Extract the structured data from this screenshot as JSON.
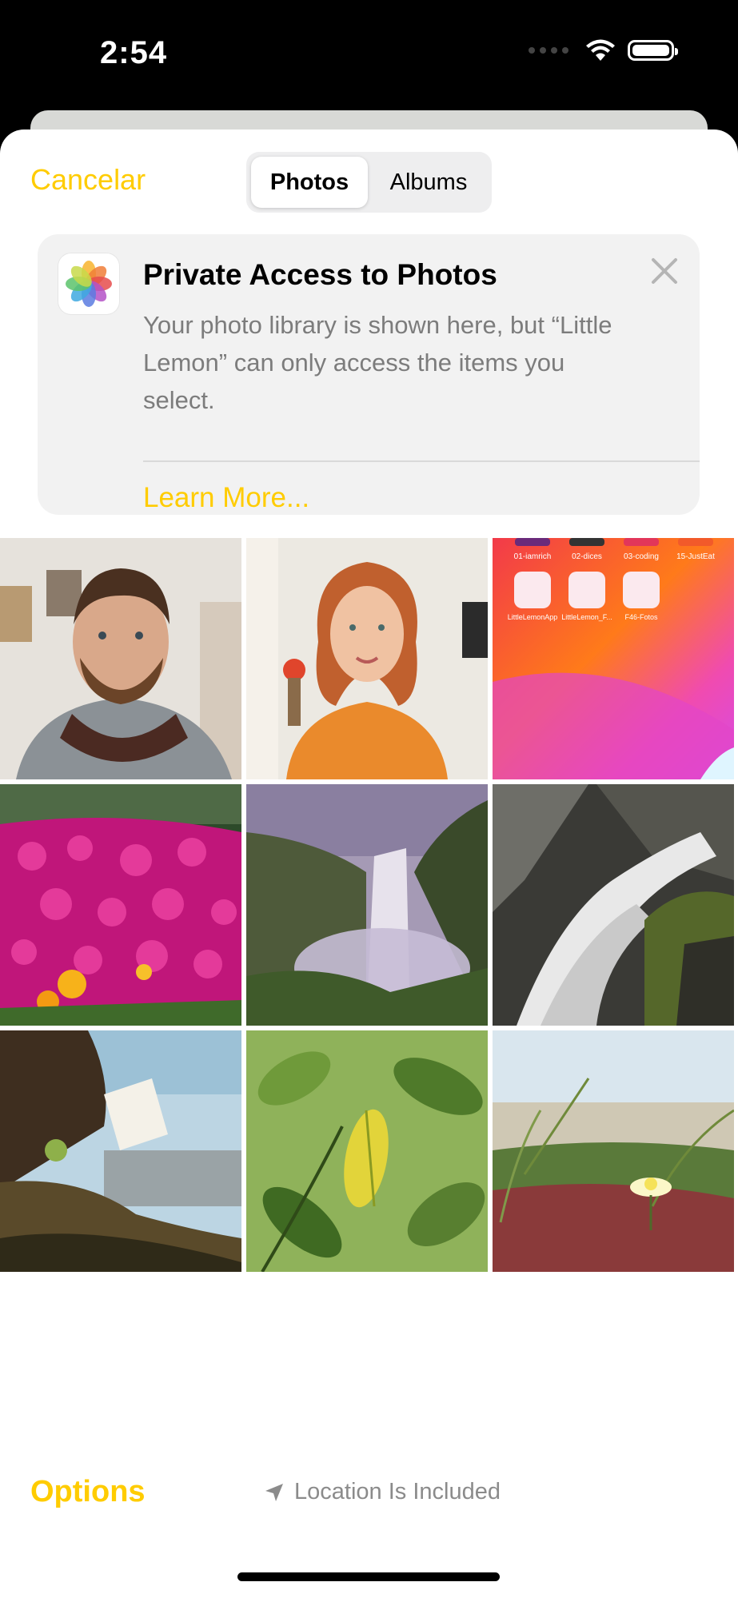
{
  "status_bar": {
    "time": "2:54",
    "icons": [
      "cellular-icon",
      "wifi-icon",
      "battery-icon"
    ]
  },
  "header": {
    "cancel_label": "Cancelar",
    "tabs": [
      {
        "label": "Photos",
        "selected": true
      },
      {
        "label": "Albums",
        "selected": false
      }
    ]
  },
  "privacy_card": {
    "app_icon": "photos-app-icon",
    "title": "Private Access to Photos",
    "body": "Your photo library is shown here, but “Little Lemon” can only access the items you select.",
    "learn_more_label": "Learn More...",
    "close_icon": "close-icon"
  },
  "photo_grid": {
    "tiles": [
      {
        "subject": "portrait-man"
      },
      {
        "subject": "portrait-woman"
      },
      {
        "subject": "screenshot-home-screen",
        "labels": [
          "01-iamrich",
          "02-dices",
          "03-coding",
          "15-JustEat",
          "LittleLemonApp",
          "LittleLemon_F...",
          "F46-Fotos"
        ]
      },
      {
        "subject": "pink-flowers"
      },
      {
        "subject": "waterfall-mist"
      },
      {
        "subject": "waterfall-rocks"
      },
      {
        "subject": "waterfall-sunset"
      },
      {
        "subject": "green-leaves"
      },
      {
        "subject": "beach-flower"
      }
    ]
  },
  "footer": {
    "options_label": "Options",
    "location_label": "Location Is Included",
    "location_icon": "location-arrow-icon"
  },
  "colors": {
    "accent": "#ffcc00",
    "background": "#ffffff",
    "card": "#f2f2f2"
  }
}
